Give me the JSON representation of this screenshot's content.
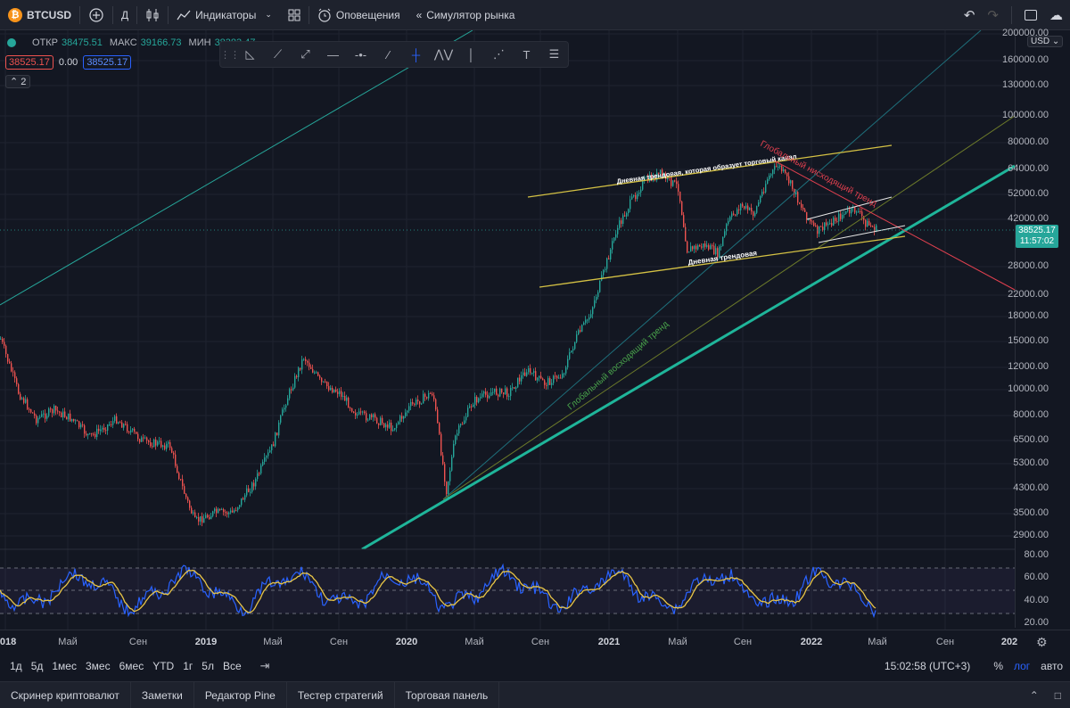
{
  "toolbar": {
    "symbol": "BTCUSD",
    "symbol_icon_letter": "₿",
    "add_symbol_icon": "plus-circle-icon",
    "interval": "Д",
    "candle_icon": "candlestick-icon",
    "indicators_label": "Индикаторы",
    "layouts_icon": "grid-icon",
    "alerts_label": "Оповещения",
    "replay_label": "Симулятор рынка"
  },
  "legend": {
    "open_label": "ОТКР",
    "open_value": "38475.51",
    "high_label": "МАКС",
    "high_value": "39166.73",
    "low_label": "МИН",
    "low_value": "38383.47",
    "sell_price": "38525.17",
    "spread": "0.00",
    "buy_price": "38525.17",
    "collapsed_count": "2"
  },
  "right_axis": {
    "currency": "USD",
    "labels": [
      "200000.00",
      "160000.00",
      "130000.00",
      "100000.00",
      "80000.00",
      "64000.00",
      "52000.00",
      "42000.00",
      "28000.00",
      "22000.00",
      "18000.00",
      "15000.00",
      "12000.00",
      "10000.00",
      "8000.00",
      "6500.00",
      "5300.00",
      "4300.00",
      "3500.00",
      "2900.00",
      "80.00",
      "60.00",
      "40.00",
      "20.00"
    ],
    "current_price": "38525.17",
    "countdown": "11:57:02"
  },
  "x_axis": {
    "labels": [
      "2018",
      "Май",
      "Сен",
      "2019",
      "Май",
      "Сен",
      "2020",
      "Май",
      "Сен",
      "2021",
      "Май",
      "Сен",
      "2022",
      "Май",
      "Сен",
      "202"
    ]
  },
  "annotations": {
    "channel_text": "Дневная трендовая, которая образует торговый канал",
    "daily_trend_text": "Дневная трендовая",
    "global_down_text": "Глобальный нисходящий тренд",
    "global_up_text": "Глобальный восходящий тренд"
  },
  "ranges": [
    "1д",
    "5д",
    "1мес",
    "3мес",
    "6мес",
    "YTD",
    "1г",
    "5л",
    "Все"
  ],
  "status": {
    "time": "15:02:58 (UTC+3)",
    "percent": "%",
    "log": "лог",
    "auto": "авто"
  },
  "footer": [
    "Скринер криптовалют",
    "Заметки",
    "Редактор Pine",
    "Тестер стратегий",
    "Торговая панель"
  ],
  "colors": {
    "up": "#26a69a",
    "down": "#ef5350",
    "trend_yellow": "#d4c144",
    "rsi": "#2962ff",
    "rsi_ma": "#e8c547"
  }
}
